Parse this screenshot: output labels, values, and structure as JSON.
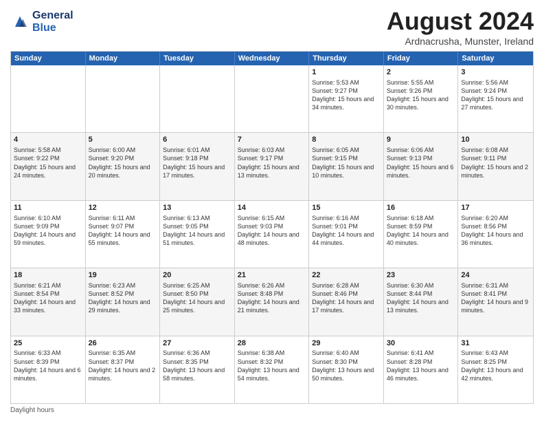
{
  "header": {
    "logo_line1": "General",
    "logo_line2": "Blue",
    "month_title": "August 2024",
    "location": "Ardnacrusha, Munster, Ireland"
  },
  "days_of_week": [
    "Sunday",
    "Monday",
    "Tuesday",
    "Wednesday",
    "Thursday",
    "Friday",
    "Saturday"
  ],
  "weeks": [
    [
      {
        "day": "",
        "info": ""
      },
      {
        "day": "",
        "info": ""
      },
      {
        "day": "",
        "info": ""
      },
      {
        "day": "",
        "info": ""
      },
      {
        "day": "1",
        "info": "Sunrise: 5:53 AM\nSunset: 9:27 PM\nDaylight: 15 hours and 34 minutes."
      },
      {
        "day": "2",
        "info": "Sunrise: 5:55 AM\nSunset: 9:26 PM\nDaylight: 15 hours and 30 minutes."
      },
      {
        "day": "3",
        "info": "Sunrise: 5:56 AM\nSunset: 9:24 PM\nDaylight: 15 hours and 27 minutes."
      }
    ],
    [
      {
        "day": "4",
        "info": "Sunrise: 5:58 AM\nSunset: 9:22 PM\nDaylight: 15 hours and 24 minutes."
      },
      {
        "day": "5",
        "info": "Sunrise: 6:00 AM\nSunset: 9:20 PM\nDaylight: 15 hours and 20 minutes."
      },
      {
        "day": "6",
        "info": "Sunrise: 6:01 AM\nSunset: 9:18 PM\nDaylight: 15 hours and 17 minutes."
      },
      {
        "day": "7",
        "info": "Sunrise: 6:03 AM\nSunset: 9:17 PM\nDaylight: 15 hours and 13 minutes."
      },
      {
        "day": "8",
        "info": "Sunrise: 6:05 AM\nSunset: 9:15 PM\nDaylight: 15 hours and 10 minutes."
      },
      {
        "day": "9",
        "info": "Sunrise: 6:06 AM\nSunset: 9:13 PM\nDaylight: 15 hours and 6 minutes."
      },
      {
        "day": "10",
        "info": "Sunrise: 6:08 AM\nSunset: 9:11 PM\nDaylight: 15 hours and 2 minutes."
      }
    ],
    [
      {
        "day": "11",
        "info": "Sunrise: 6:10 AM\nSunset: 9:09 PM\nDaylight: 14 hours and 59 minutes."
      },
      {
        "day": "12",
        "info": "Sunrise: 6:11 AM\nSunset: 9:07 PM\nDaylight: 14 hours and 55 minutes."
      },
      {
        "day": "13",
        "info": "Sunrise: 6:13 AM\nSunset: 9:05 PM\nDaylight: 14 hours and 51 minutes."
      },
      {
        "day": "14",
        "info": "Sunrise: 6:15 AM\nSunset: 9:03 PM\nDaylight: 14 hours and 48 minutes."
      },
      {
        "day": "15",
        "info": "Sunrise: 6:16 AM\nSunset: 9:01 PM\nDaylight: 14 hours and 44 minutes."
      },
      {
        "day": "16",
        "info": "Sunrise: 6:18 AM\nSunset: 8:59 PM\nDaylight: 14 hours and 40 minutes."
      },
      {
        "day": "17",
        "info": "Sunrise: 6:20 AM\nSunset: 8:56 PM\nDaylight: 14 hours and 36 minutes."
      }
    ],
    [
      {
        "day": "18",
        "info": "Sunrise: 6:21 AM\nSunset: 8:54 PM\nDaylight: 14 hours and 33 minutes."
      },
      {
        "day": "19",
        "info": "Sunrise: 6:23 AM\nSunset: 8:52 PM\nDaylight: 14 hours and 29 minutes."
      },
      {
        "day": "20",
        "info": "Sunrise: 6:25 AM\nSunset: 8:50 PM\nDaylight: 14 hours and 25 minutes."
      },
      {
        "day": "21",
        "info": "Sunrise: 6:26 AM\nSunset: 8:48 PM\nDaylight: 14 hours and 21 minutes."
      },
      {
        "day": "22",
        "info": "Sunrise: 6:28 AM\nSunset: 8:46 PM\nDaylight: 14 hours and 17 minutes."
      },
      {
        "day": "23",
        "info": "Sunrise: 6:30 AM\nSunset: 8:44 PM\nDaylight: 14 hours and 13 minutes."
      },
      {
        "day": "24",
        "info": "Sunrise: 6:31 AM\nSunset: 8:41 PM\nDaylight: 14 hours and 9 minutes."
      }
    ],
    [
      {
        "day": "25",
        "info": "Sunrise: 6:33 AM\nSunset: 8:39 PM\nDaylight: 14 hours and 6 minutes."
      },
      {
        "day": "26",
        "info": "Sunrise: 6:35 AM\nSunset: 8:37 PM\nDaylight: 14 hours and 2 minutes."
      },
      {
        "day": "27",
        "info": "Sunrise: 6:36 AM\nSunset: 8:35 PM\nDaylight: 13 hours and 58 minutes."
      },
      {
        "day": "28",
        "info": "Sunrise: 6:38 AM\nSunset: 8:32 PM\nDaylight: 13 hours and 54 minutes."
      },
      {
        "day": "29",
        "info": "Sunrise: 6:40 AM\nSunset: 8:30 PM\nDaylight: 13 hours and 50 minutes."
      },
      {
        "day": "30",
        "info": "Sunrise: 6:41 AM\nSunset: 8:28 PM\nDaylight: 13 hours and 46 minutes."
      },
      {
        "day": "31",
        "info": "Sunrise: 6:43 AM\nSunset: 8:25 PM\nDaylight: 13 hours and 42 minutes."
      }
    ]
  ],
  "footer": "Daylight hours"
}
